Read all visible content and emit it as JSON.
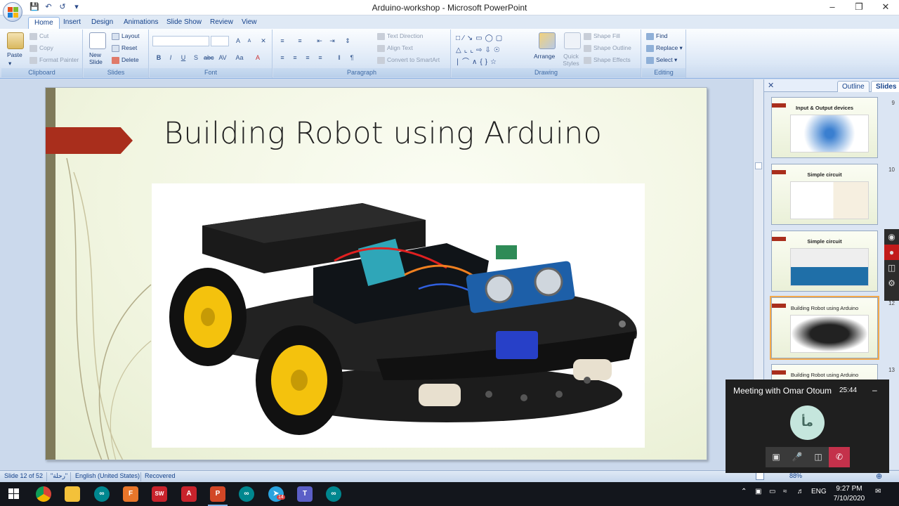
{
  "window": {
    "title": "Arduino-workshop - Microsoft PowerPoint"
  },
  "window_controls": [
    "–",
    "❐",
    "✕"
  ],
  "ribbon": {
    "tabs": [
      "Home",
      "Insert",
      "Design",
      "Animations",
      "Slide Show",
      "Review",
      "View"
    ],
    "clipboard": {
      "name": "Clipboard",
      "paste": "Paste",
      "cut": "Cut",
      "copy": "Copy",
      "format_painter": "Format Painter"
    },
    "slides": {
      "name": "Slides",
      "new_slide": "New Slide",
      "layout": "Layout",
      "reset": "Reset",
      "delete": "Delete"
    },
    "font": {
      "name": "Font"
    },
    "paragraph": {
      "name": "Paragraph",
      "text_direction": "Text Direction",
      "align_text": "Align Text",
      "convert_smartart": "Convert to SmartArt"
    },
    "drawing": {
      "name": "Drawing",
      "arrange": "Arrange",
      "quick_styles": "Quick Styles",
      "shape_fill": "Shape Fill",
      "shape_outline": "Shape Outline",
      "shape_effects": "Shape Effects"
    },
    "editing": {
      "name": "Editing",
      "find": "Find",
      "replace": "Replace",
      "select": "Select"
    }
  },
  "slide": {
    "title": "Building Robot using Arduino",
    "image_alt": "Arduino robot car kit"
  },
  "panel": {
    "tabs": [
      "Outline",
      "Slides"
    ],
    "close": "✕",
    "thumbnails": [
      {
        "num": "9",
        "title": "Input & Output devices"
      },
      {
        "num": "10",
        "title": "Simple circuit"
      },
      {
        "num": "11",
        "title": "Simple circuit"
      },
      {
        "num": "12",
        "title": "Building Robot using Arduino"
      },
      {
        "num": "13",
        "title": "Building Robot using Arduino"
      }
    ]
  },
  "status": {
    "slide_info": "Slide 12 of 52",
    "theme": "\"رحلة\"",
    "language": "English (United States)",
    "recovered": "Recovered",
    "zoom": "88%"
  },
  "meeting": {
    "title": "Meeting with Omar Otoum",
    "time": "25:44",
    "minimize": "–",
    "avatar_initials": "مأ",
    "controls": [
      "video-off",
      "mic",
      "share",
      "hang-up"
    ]
  },
  "taskbar": {
    "apps": [
      "chrome",
      "file-explorer",
      "arduino",
      "f-app",
      "solidworks",
      "autocad",
      "powerpoint",
      "arduino",
      "telegram",
      "teams",
      "arduino"
    ],
    "telegram_badge": "14",
    "language": "ENG",
    "time": "9:27 PM",
    "date": "7/10/2020"
  },
  "colors": {
    "accent_red": "#a92e1c",
    "ribbon_blue": "#15428b",
    "teams_end": "#c4314b"
  }
}
